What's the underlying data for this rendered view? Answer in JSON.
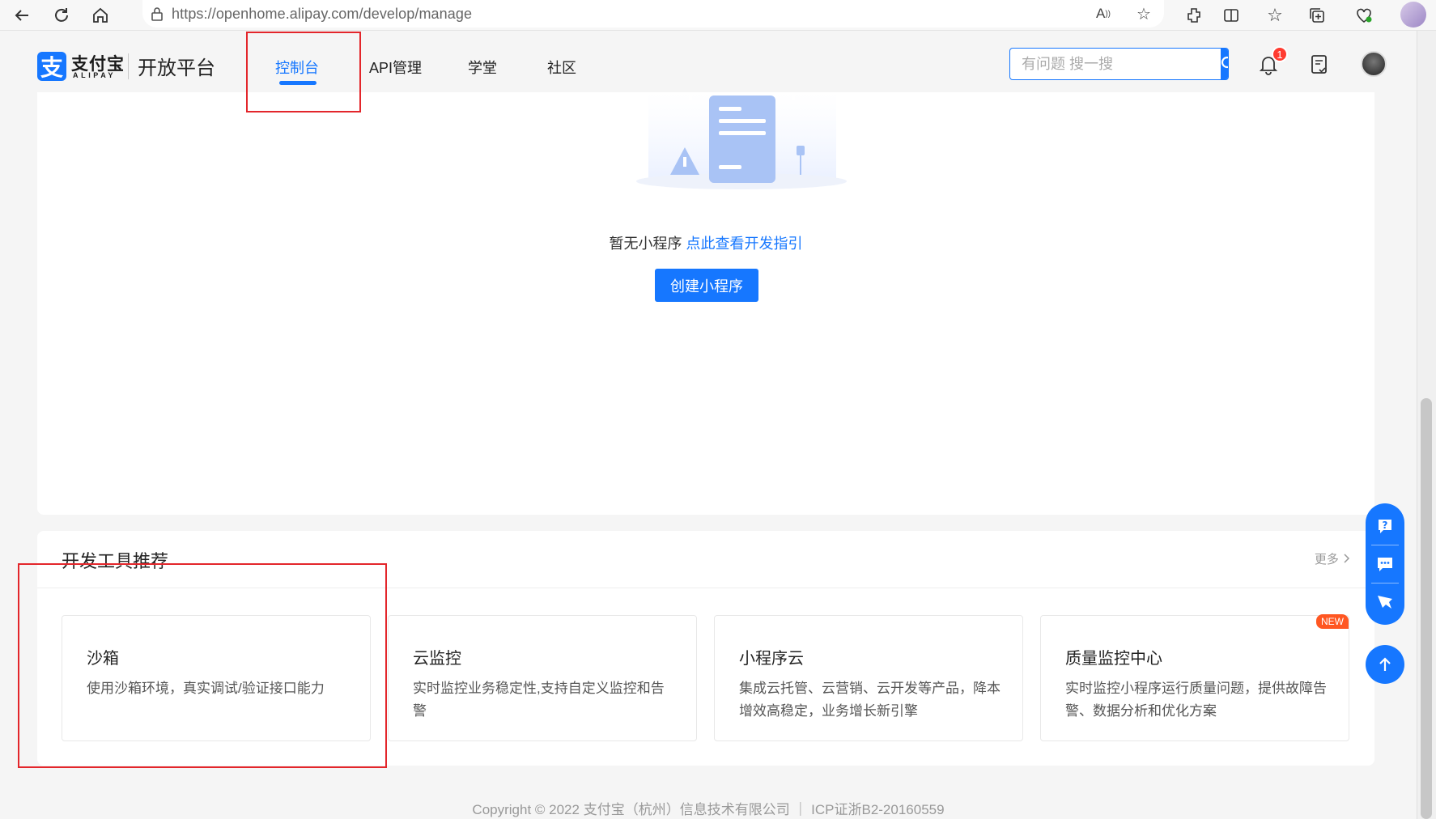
{
  "browser": {
    "url": "https://openhome.alipay.com/develop/manage"
  },
  "header": {
    "logo_text": "支付宝",
    "logo_sub": "ALIPAY",
    "platform_title": "开放平台",
    "tabs": [
      {
        "label": "控制台",
        "active": true
      },
      {
        "label": "API管理",
        "active": false
      },
      {
        "label": "学堂",
        "active": false
      },
      {
        "label": "社区",
        "active": false
      }
    ],
    "search": {
      "placeholder": "有问题 搜一搜"
    },
    "notification_count": "1"
  },
  "empty_state": {
    "text": "暂无小程序",
    "link": "点此查看开发指引",
    "create_button": "创建小程序"
  },
  "tools": {
    "title": "开发工具推荐",
    "more": "更多",
    "items": [
      {
        "name": "沙箱",
        "desc": "使用沙箱环境，真实调试/验证接口能力",
        "new": false
      },
      {
        "name": "云监控",
        "desc": "实时监控业务稳定性,支持自定义监控和告警",
        "new": false
      },
      {
        "name": "小程序云",
        "desc": "集成云托管、云营销、云开发等产品，降本增效高稳定，业务增长新引擎",
        "new": false
      },
      {
        "name": "质量监控中心",
        "desc": "实时监控小程序运行质量问题，提供故障告警、数据分析和优化方案",
        "new": true,
        "badge": "NEW"
      }
    ]
  },
  "footer": {
    "copyright": "Copyright © 2022 支付宝（杭州）信息技术有限公司 ｜ ICP证浙B2-20160559"
  },
  "colors": {
    "accent": "#1677ff",
    "highlight": "#e3262b",
    "badge": "#ff3b30",
    "new_badge": "#ff5722"
  }
}
